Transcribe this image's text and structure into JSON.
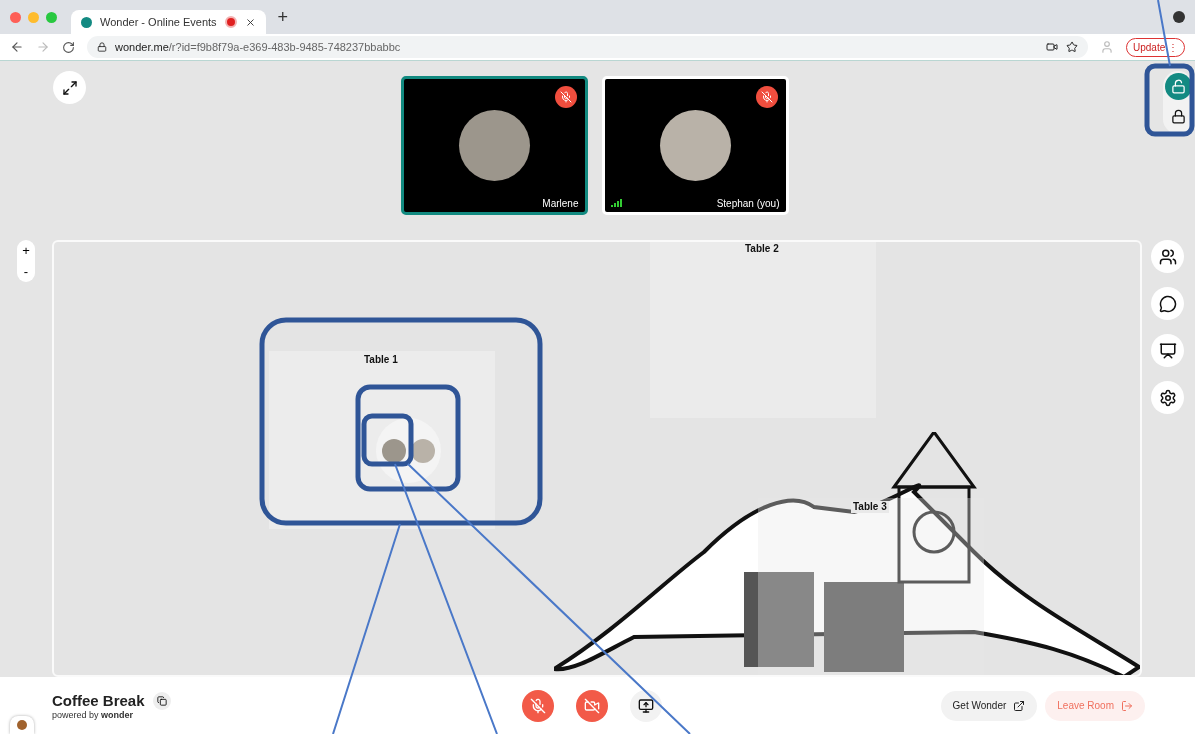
{
  "browser": {
    "tab_title": "Wonder - Online Events",
    "recording": true,
    "new_tab": "+",
    "url_domain": "wonder.me",
    "url_path": "/r?id=f9b8f79a-e369-483b-9485-748237bbabbc",
    "update_button": "Update",
    "update_menu": "⋮"
  },
  "videos": [
    {
      "name": "Marlene",
      "muted": true,
      "highlighted": true,
      "kind": "blurred"
    },
    {
      "name": "Stephan (you)",
      "muted": true,
      "highlighted": false,
      "kind": "person"
    }
  ],
  "lock_options": [
    {
      "kind": "unlocked",
      "selected": true
    },
    {
      "kind": "locked",
      "selected": false
    }
  ],
  "zoom_controls": [
    "+",
    "-"
  ],
  "side_buttons": [
    {
      "kind": "people"
    },
    {
      "kind": "chat"
    },
    {
      "kind": "presenter"
    },
    {
      "kind": "settings"
    }
  ],
  "tables": [
    {
      "label": "Table 1",
      "kind": "plain"
    },
    {
      "label": "Table 2",
      "kind": "plain"
    },
    {
      "label": "Table 3",
      "kind": "mountain"
    }
  ],
  "room": {
    "name": "Coffee Break",
    "powered_by": "powered by **wonder**"
  },
  "controls": [
    {
      "kind": "mic",
      "on": false
    },
    {
      "kind": "camera",
      "on": false
    },
    {
      "kind": "share",
      "on": false
    }
  ],
  "actions": [
    {
      "label": "Get Wonder",
      "kind": "external"
    },
    {
      "label": "Leave Room",
      "kind": "leave"
    }
  ]
}
